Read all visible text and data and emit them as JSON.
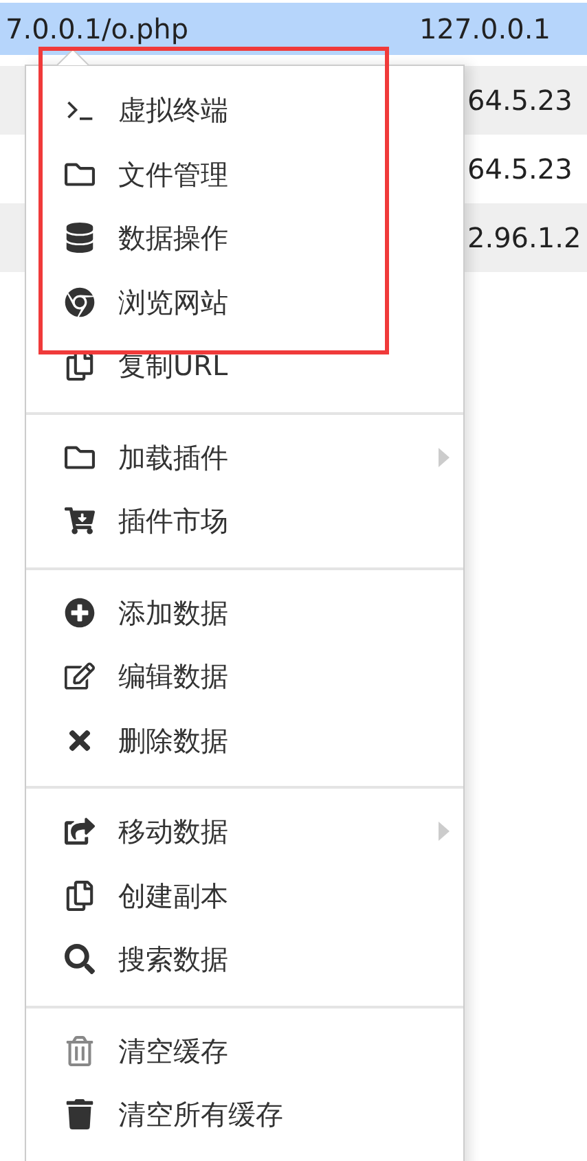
{
  "table": {
    "rows": [
      {
        "url": "7.0.0.1/o.php",
        "ip": "127.0.0.1",
        "selected": true
      },
      {
        "ip": "64.5.23",
        "selected": false
      },
      {
        "ip": "64.5.23",
        "selected": false
      },
      {
        "ip": "2.96.1.2",
        "selected": false
      }
    ]
  },
  "context_menu": {
    "highlight_frame": true,
    "groups": [
      {
        "items": [
          {
            "label": "虚拟终端",
            "kind": "terminal",
            "submenu": false
          },
          {
            "label": "文件管理",
            "kind": "folder",
            "submenu": false
          },
          {
            "label": "数据操作",
            "kind": "database",
            "submenu": false
          },
          {
            "label": "浏览网站",
            "kind": "browser",
            "submenu": false
          },
          {
            "label": "复制URL",
            "kind": "copy",
            "submenu": false
          }
        ]
      },
      {
        "items": [
          {
            "label": "加载插件",
            "kind": "folder",
            "submenu": true
          },
          {
            "label": "插件市场",
            "kind": "cart",
            "submenu": false
          }
        ]
      },
      {
        "items": [
          {
            "label": "添加数据",
            "kind": "add",
            "submenu": false
          },
          {
            "label": "编辑数据",
            "kind": "edit",
            "submenu": false
          },
          {
            "label": "删除数据",
            "kind": "delete",
            "submenu": false
          }
        ]
      },
      {
        "items": [
          {
            "label": "移动数据",
            "kind": "move",
            "submenu": true
          },
          {
            "label": "创建副本",
            "kind": "copy",
            "submenu": false
          },
          {
            "label": "搜索数据",
            "kind": "search",
            "submenu": false
          }
        ]
      },
      {
        "items": [
          {
            "label": "清空缓存",
            "kind": "trash-light",
            "submenu": false
          },
          {
            "label": "清空所有缓存",
            "kind": "trash",
            "submenu": false
          }
        ]
      }
    ]
  }
}
